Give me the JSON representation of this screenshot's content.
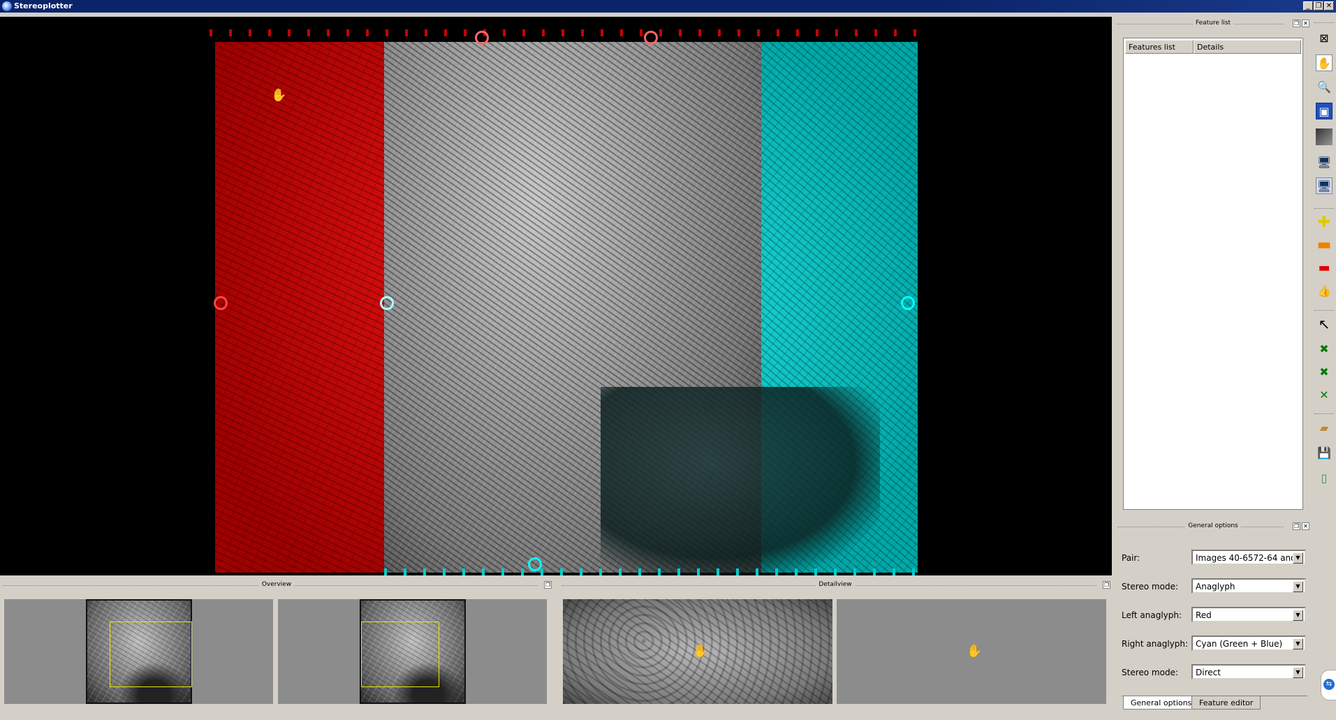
{
  "window": {
    "title": "Stereoplotter",
    "minimize": "_",
    "restore": "❐",
    "close": "✕"
  },
  "docks": {
    "feature_list_title": "Feature list",
    "general_options_title": "General options",
    "overview_title": "Overview",
    "detailview_title": "Detailview"
  },
  "feature_table": {
    "columns": [
      "Features list",
      "Details"
    ]
  },
  "options": [
    {
      "label": "Pair:",
      "value": "Images 40-6572-64 and"
    },
    {
      "label": "Stereo mode:",
      "value": "Anaglyph"
    },
    {
      "label": "Left anaglyph:",
      "value": "Red"
    },
    {
      "label": "Right anaglyph:",
      "value": "Cyan (Green + Blue)"
    },
    {
      "label": "Stereo mode:",
      "value": "Direct"
    }
  ],
  "tabs": [
    {
      "label": "General options",
      "active": true
    },
    {
      "label": "Feature editor",
      "active": false
    }
  ],
  "toolbar_icons": [
    "grid-icon",
    "hand-pan-icon",
    "zoom-icon",
    "fit-view-icon",
    "texture-icon",
    "monitor-icon",
    "dual-monitor-icon",
    "add-point-icon",
    "remove-icon",
    "remove-all-icon",
    "thumb-icon",
    "pointer-icon",
    "add-feature-icon",
    "edit-feature-icon",
    "remove-feature-icon",
    "open-folder-icon",
    "save-icon",
    "document-icon"
  ],
  "colors": {
    "left_anaglyph": "#ff0000",
    "right_anaglyph": "#00ffff",
    "overview_rect": "#e8e800"
  }
}
